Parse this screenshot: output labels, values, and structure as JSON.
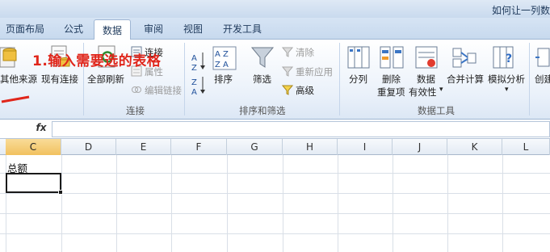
{
  "window": {
    "title": "如何让一列数"
  },
  "tabs": [
    {
      "label": "页面布局"
    },
    {
      "label": "公式"
    },
    {
      "label": "数据"
    },
    {
      "label": "审阅"
    },
    {
      "label": "视图"
    },
    {
      "label": "开发工具"
    }
  ],
  "ribbon": {
    "get_external": {
      "other_sources": "其他来源",
      "existing_connections": "现有连接"
    },
    "connections": {
      "refresh_all": "全部刷新",
      "connections": "连接",
      "properties": "属性",
      "edit_links": "编辑链接",
      "group_label": "连接"
    },
    "sort_filter": {
      "sort": "排序",
      "filter": "筛选",
      "clear": "清除",
      "reapply": "重新应用",
      "advanced": "高级",
      "group_label": "排序和筛选"
    },
    "data_tools": {
      "text_to_columns": "分列",
      "remove_duplicates_1": "删除",
      "remove_duplicates_2": "重复项",
      "data_validation_1": "数据",
      "data_validation_2": "有效性",
      "consolidate": "合并计算",
      "what_if": "模拟分析",
      "group_label": "数据工具"
    },
    "outline": {
      "create_group": "创建"
    }
  },
  "annotation": {
    "text": "1.输入需要选的表格"
  },
  "formula_bar": {
    "fx": "fx",
    "value": ""
  },
  "columns": [
    "C",
    "D",
    "E",
    "F",
    "G",
    "H",
    "I",
    "J",
    "K",
    "L"
  ],
  "selected_column": "C",
  "cells": {
    "C1": "总额"
  },
  "colors": {
    "accent": "#f1c15f",
    "annotation": "#e0261b",
    "ribbon_border": "#9fb6d3"
  }
}
